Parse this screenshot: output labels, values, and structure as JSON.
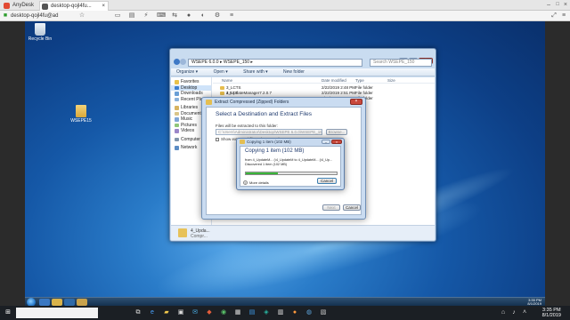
{
  "host": {
    "tabs": [
      {
        "label": "AnyDesk",
        "color": "#e24a33"
      },
      {
        "label": "desktop-qojl4fu...",
        "color": "#444444"
      }
    ],
    "address": "desktop-qojl4fu@ad",
    "taskbar": {
      "search_placeholder": "",
      "clock_time": "3:35 PM",
      "clock_date": "8/1/2019"
    }
  },
  "desktop": {
    "icons": [
      {
        "label": "Recycle Bin"
      },
      {
        "label": "WSEPE15"
      }
    ]
  },
  "explorer": {
    "address": "WSEPE 6.0.0 ▸ WSEPE_150 ▸",
    "search_placeholder": "Search WSEPE_150",
    "commands": [
      "Organize ▾",
      "Open ▾",
      "Share with ▾",
      "New folder"
    ],
    "nav": {
      "favorites": "Favorites",
      "fav_items": [
        "Desktop",
        "Downloads",
        "Recent Places"
      ],
      "libraries": "Libraries",
      "lib_items": [
        "Documents",
        "Music",
        "Pictures",
        "Videos"
      ],
      "computer": "Computer",
      "network": "Network"
    },
    "columns": {
      "name": "Name",
      "date": "Date modified",
      "type": "Type",
      "size": "Size"
    },
    "files": [
      {
        "name": "3_LCTS 2.0.17",
        "date": "2/22/2019 2:48 PM",
        "type": "File folder"
      },
      {
        "name": "4_UpdateManager7.2.0.7",
        "date": "2/22/2019 2:51 PM",
        "type": "File folder"
      },
      {
        "name": "5_WSEPE",
        "date": "2/22/2019 2:51 PM",
        "type": "File folder"
      }
    ],
    "details_name": "4_Upda...",
    "details_type": "Compr..."
  },
  "extract": {
    "title": "Extract Compressed (Zipped) Folders",
    "heading": "Select a Destination and Extract Files",
    "files_label": "Files will be extracted to this folder:",
    "path": "C:\\Users\\Administrator\\Desktop\\WSEPE 6.0.0\\WSEPE_150\\4_UpdateM...",
    "browse": "Browse...",
    "show_label": "Show extracted files when complete",
    "next": "Next",
    "cancel": "Cancel"
  },
  "copying": {
    "title": "Copying 1 item (102 MB)",
    "heading": "Copying 1 item (102 MB)",
    "from_line": "from 4_UpdateM... (\\4_UpdateM to 4_UpdateM... (\\4_Up...",
    "discovered": "Discovered 1 item (102 MB)",
    "progress_fraction": 0.35,
    "more_details": "More details",
    "cancel": "Cancel"
  },
  "taskbar": {
    "time": "3:35 PM",
    "date": "8/1/2019"
  }
}
